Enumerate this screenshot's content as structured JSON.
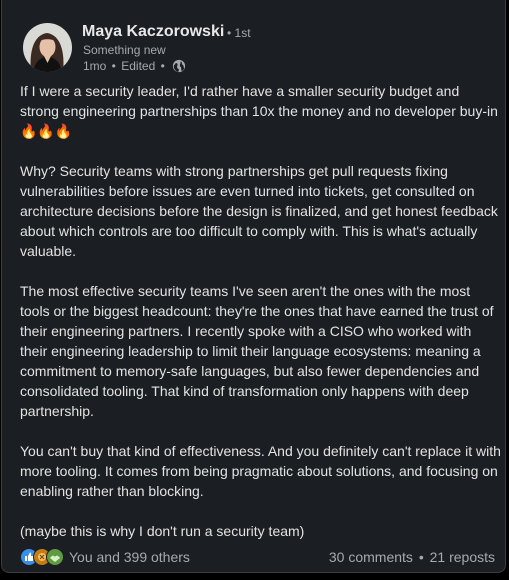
{
  "post": {
    "author": {
      "name": "Maya Kaczorowski",
      "degree": "1st",
      "headline": "Something new",
      "time": "1mo",
      "edited": "Edited",
      "visibility_icon": "globe-icon"
    },
    "paragraphs": [
      "If I were a security leader, I'd rather have a smaller security budget and strong engineering partnerships than 10x the money and no developer buy-in 🔥🔥🔥",
      "Why? Security teams with strong partnerships get pull requests fixing vulnerabilities before issues are even turned into tickets, get consulted on architecture decisions before the design is finalized, and get honest feedback about which controls are too difficult to comply with. This is what's actually valuable.",
      "The most effective security teams I've seen aren't the ones with the most tools or the biggest headcount: they're the ones that have earned the trust of their engineering partners. I recently spoke with a CISO who worked with their engineering leadership to limit their language ecosystems: meaning a commitment to memory-safe languages, but also fewer dependencies and consolidated tooling. That kind of transformation only happens with deep partnership.",
      "You can't buy that kind of effectiveness. And you definitely can't replace it with more tooling. It comes from being pragmatic about solutions, and focusing on enabling rather than blocking.",
      "(maybe this is why I don't run a security team)"
    ],
    "social": {
      "reaction_icons": [
        "like-icon",
        "celebrate-icon",
        "support-icon"
      ],
      "reactions_text": "You and 399 others",
      "comments": "30 comments",
      "reposts": "21 reposts"
    }
  },
  "colors": {
    "background": "#000000",
    "card": "#1b1f23",
    "text": "#e3e3e3",
    "muted": "#a7a9ac",
    "like": "#378fe9",
    "celebrate": "#5f9b41",
    "support": "#c37d16"
  }
}
